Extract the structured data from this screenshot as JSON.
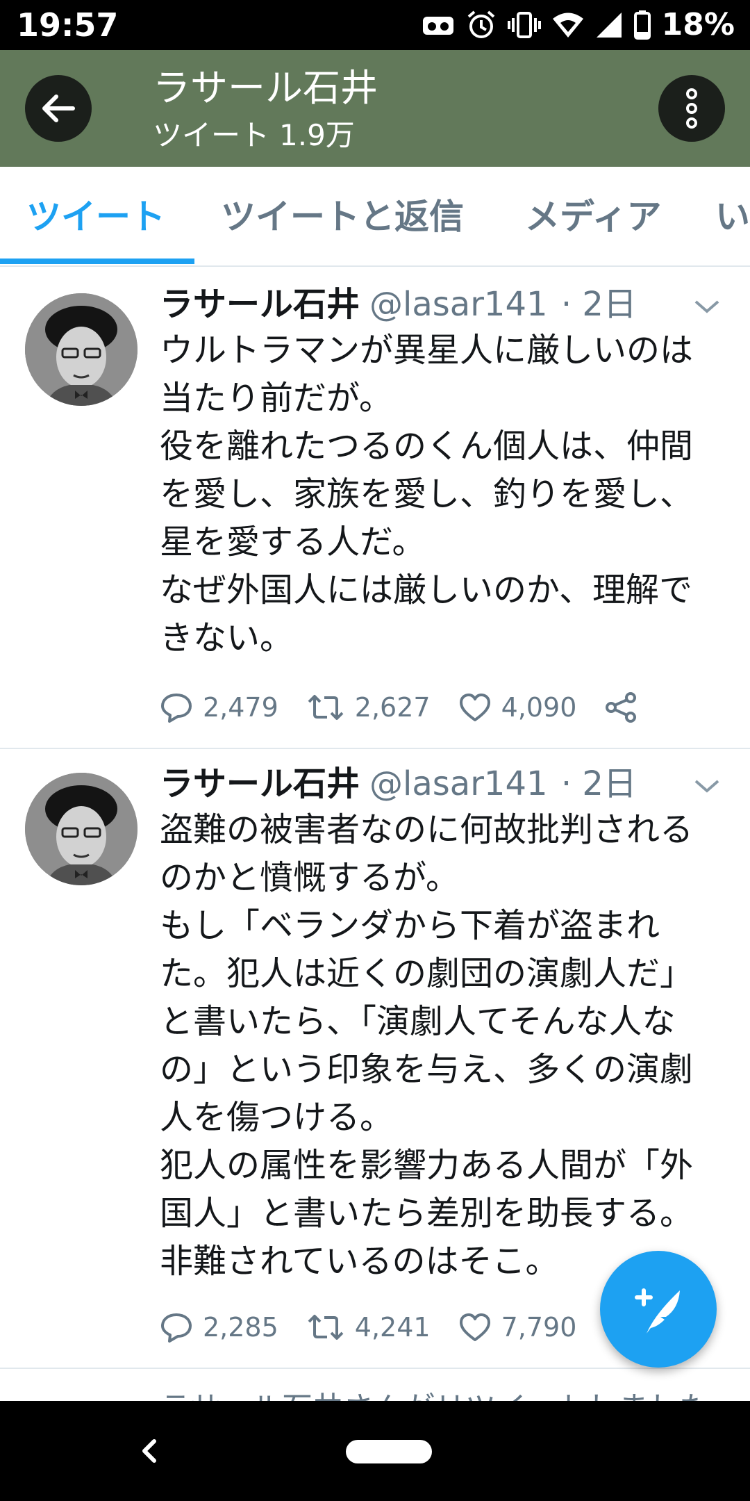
{
  "status_bar": {
    "time": "19:57",
    "battery": "18%",
    "icons": [
      "vr-icon",
      "alarm-icon",
      "vibrate-icon",
      "wifi-icon",
      "signal-icon",
      "battery-icon"
    ]
  },
  "header": {
    "title": "ラサール石井",
    "subtitle_label": "ツイート",
    "subtitle_count": "1.9万",
    "header_color": "#62795a"
  },
  "tabs": [
    {
      "label": "ツイート",
      "active": true
    },
    {
      "label": "ツイートと返信",
      "active": false
    },
    {
      "label": "メディア",
      "active": false
    },
    {
      "label": "い",
      "active": false
    }
  ],
  "tweets": [
    {
      "name": "ラサール石井",
      "handle": "@lasar141",
      "time": "· 2日",
      "lines": [
        "ウルトラマンが異星人に厳しいのは",
        "当たり前だが。",
        "役を離れたつるのくん個人は、仲間",
        "を愛し、家族を愛し、釣りを愛し、",
        "星を愛する人だ。",
        "なぜ外国人には厳しいのか、理解で",
        "きない。"
      ],
      "replies": "2,479",
      "retweets": "2,627",
      "likes": "4,090"
    },
    {
      "name": "ラサール石井",
      "handle": "@lasar141",
      "time": "· 2日",
      "lines": [
        "盗難の被害者なのに何故批判される",
        "のかと憤慨するが。",
        "もし「ベランダから下着が盗まれ",
        "た。犯人は近くの劇団の演劇人だ」",
        "と書いたら、「演劇人てそんな人な",
        "の」という印象を与え、多くの演劇",
        "人を傷つける。",
        "犯人の属性を影響力ある人間が「外",
        "国人」と書いたら差別を助長する。",
        "非難されているのはそこ。"
      ],
      "replies": "2,285",
      "retweets": "4,241",
      "likes": "7,790"
    }
  ],
  "peek_text": "ラサール石井さんがリツイートしました",
  "accent_color": "#1da1f2"
}
